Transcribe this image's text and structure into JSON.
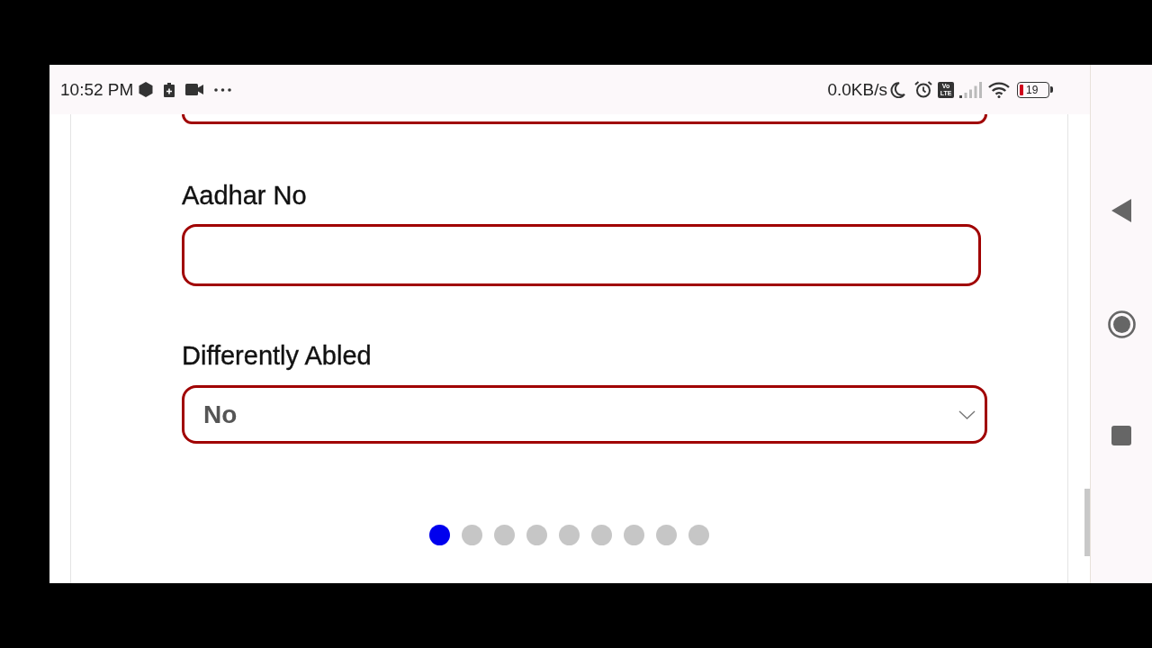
{
  "status_bar": {
    "time": "10:52 PM",
    "network_speed": "0.0KB/s",
    "volte_label": "Vo LTE",
    "battery_text": "19"
  },
  "form": {
    "fields": [
      {
        "kind": "cut_off"
      },
      {
        "kind": "text",
        "label": "Aadhar No"
      },
      {
        "kind": "select",
        "label": "Differently Abled",
        "value": "No"
      }
    ]
  },
  "pager": {
    "dots": [
      {
        "selected": true
      },
      {
        "selected": false
      },
      {
        "selected": false
      },
      {
        "selected": false
      },
      {
        "selected": false
      },
      {
        "selected": false
      },
      {
        "selected": false
      },
      {
        "selected": false
      },
      {
        "selected": false
      }
    ]
  }
}
